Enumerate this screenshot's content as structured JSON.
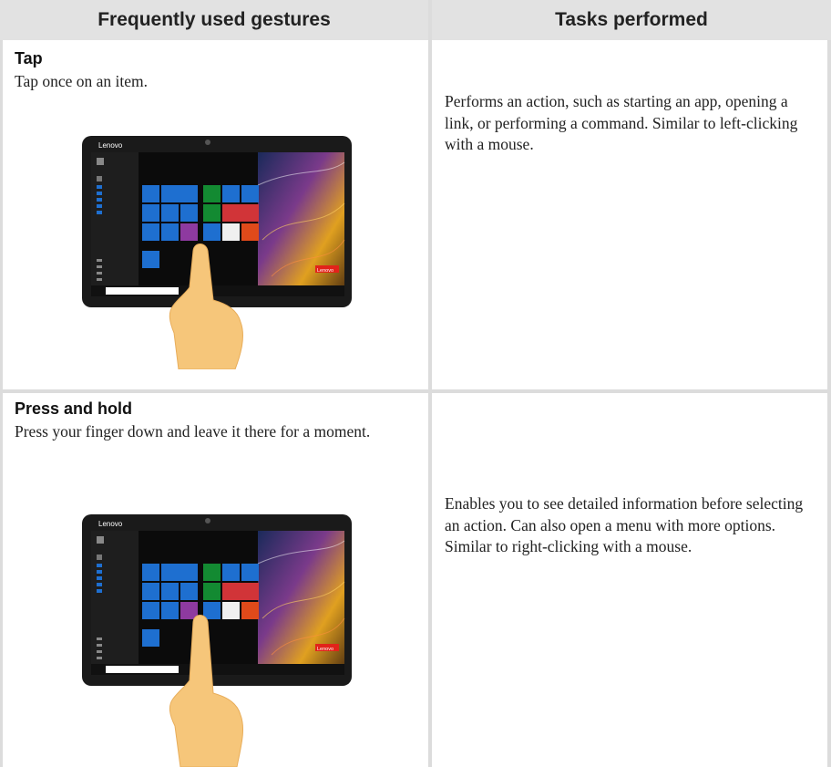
{
  "header": {
    "col1": "Frequently used gestures",
    "col2": "Tasks performed"
  },
  "rows": [
    {
      "gesture": "Tap",
      "description": "Tap once on an item.",
      "task": "Performs an action, such as starting an app, opening a link, or performing a command. Similar to left-clicking with a mouse."
    },
    {
      "gesture": "Press and hold",
      "description": "Press your finger down and leave it there for a moment.",
      "task": "Enables you to see detailed information before selecting an action. Can also open a menu with more options. Similar to right-clicking with a mouse."
    }
  ],
  "tablet": {
    "brand": "Lenovo",
    "wallpaper_brand": "Lenovo"
  }
}
